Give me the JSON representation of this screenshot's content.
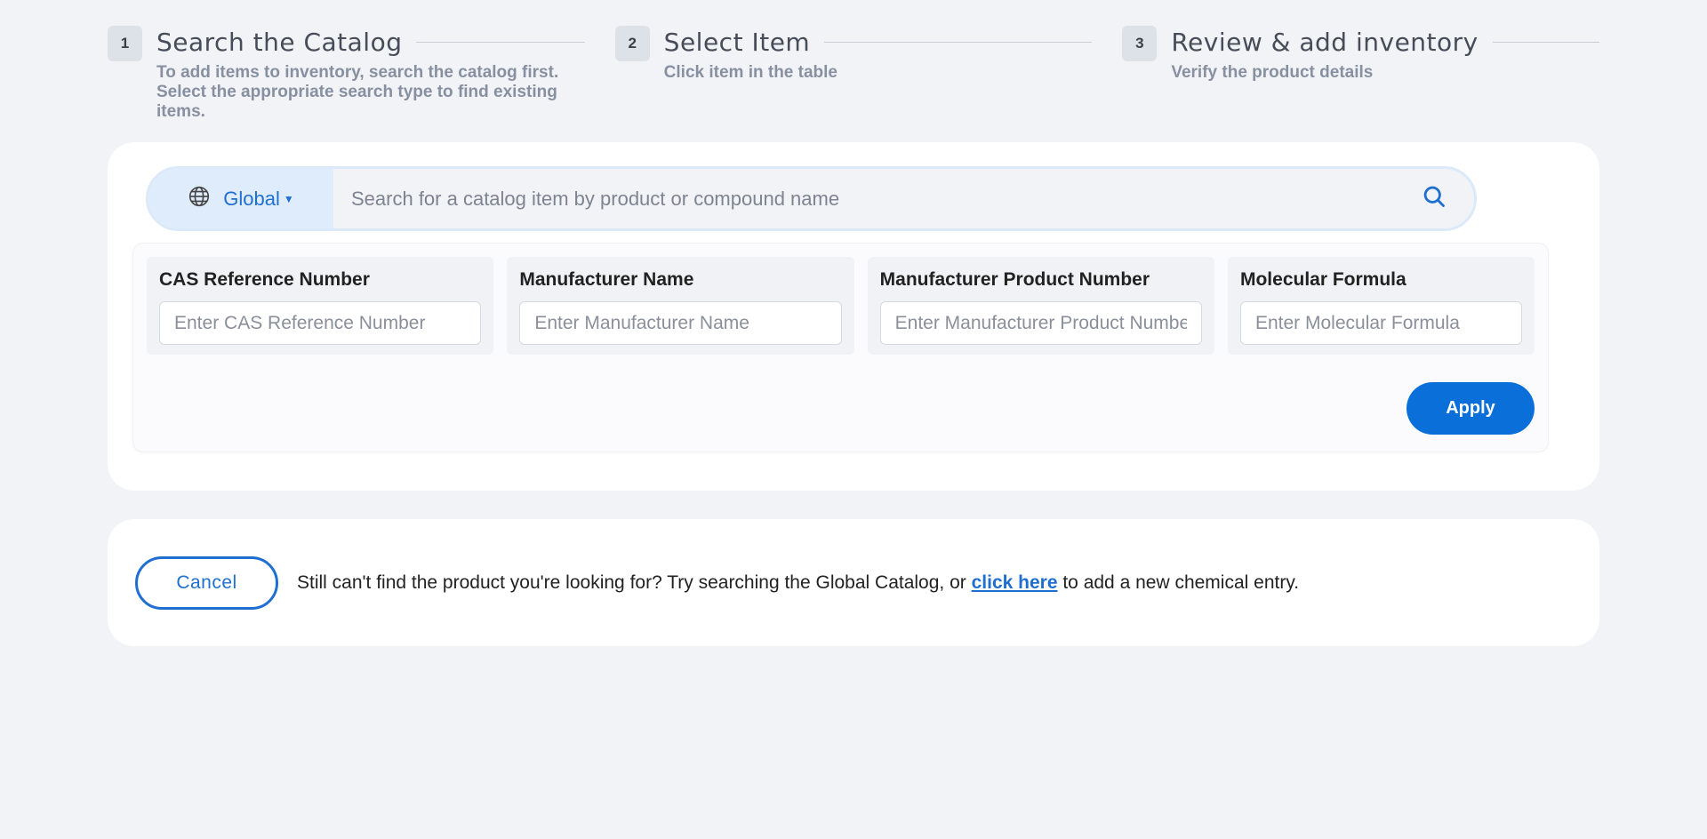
{
  "steps": [
    {
      "number": "1",
      "title": "Search the Catalog",
      "description": "To add items to inventory, search the catalog first. Select the appropriate search type to find existing items."
    },
    {
      "number": "2",
      "title": "Select Item",
      "description": "Click item in the table"
    },
    {
      "number": "3",
      "title": "Review & add inventory",
      "description": "Verify the product details"
    }
  ],
  "search": {
    "scope_label": "Global",
    "scope_icon": "globe-icon",
    "placeholder": "Search for a catalog item by product or compound name",
    "value": "",
    "button_icon": "search-icon"
  },
  "filters": [
    {
      "label": "CAS Reference Number",
      "placeholder": "Enter CAS Reference Number"
    },
    {
      "label": "Manufacturer Name",
      "placeholder": "Enter Manufacturer Name"
    },
    {
      "label": "Manufacturer Product Number",
      "placeholder": "Enter Manufacturer Product Number"
    },
    {
      "label": "Molecular Formula",
      "placeholder": "Enter Molecular Formula"
    }
  ],
  "apply_label": "Apply",
  "footer": {
    "cancel_label": "Cancel",
    "text_before": "Still can't find the product you're looking for? Try searching the Global Catalog, or ",
    "link_text": "click here",
    "text_after": " to add a new chemical entry."
  },
  "colors": {
    "accent": "#0a6fd8",
    "background": "#f2f3f7"
  }
}
